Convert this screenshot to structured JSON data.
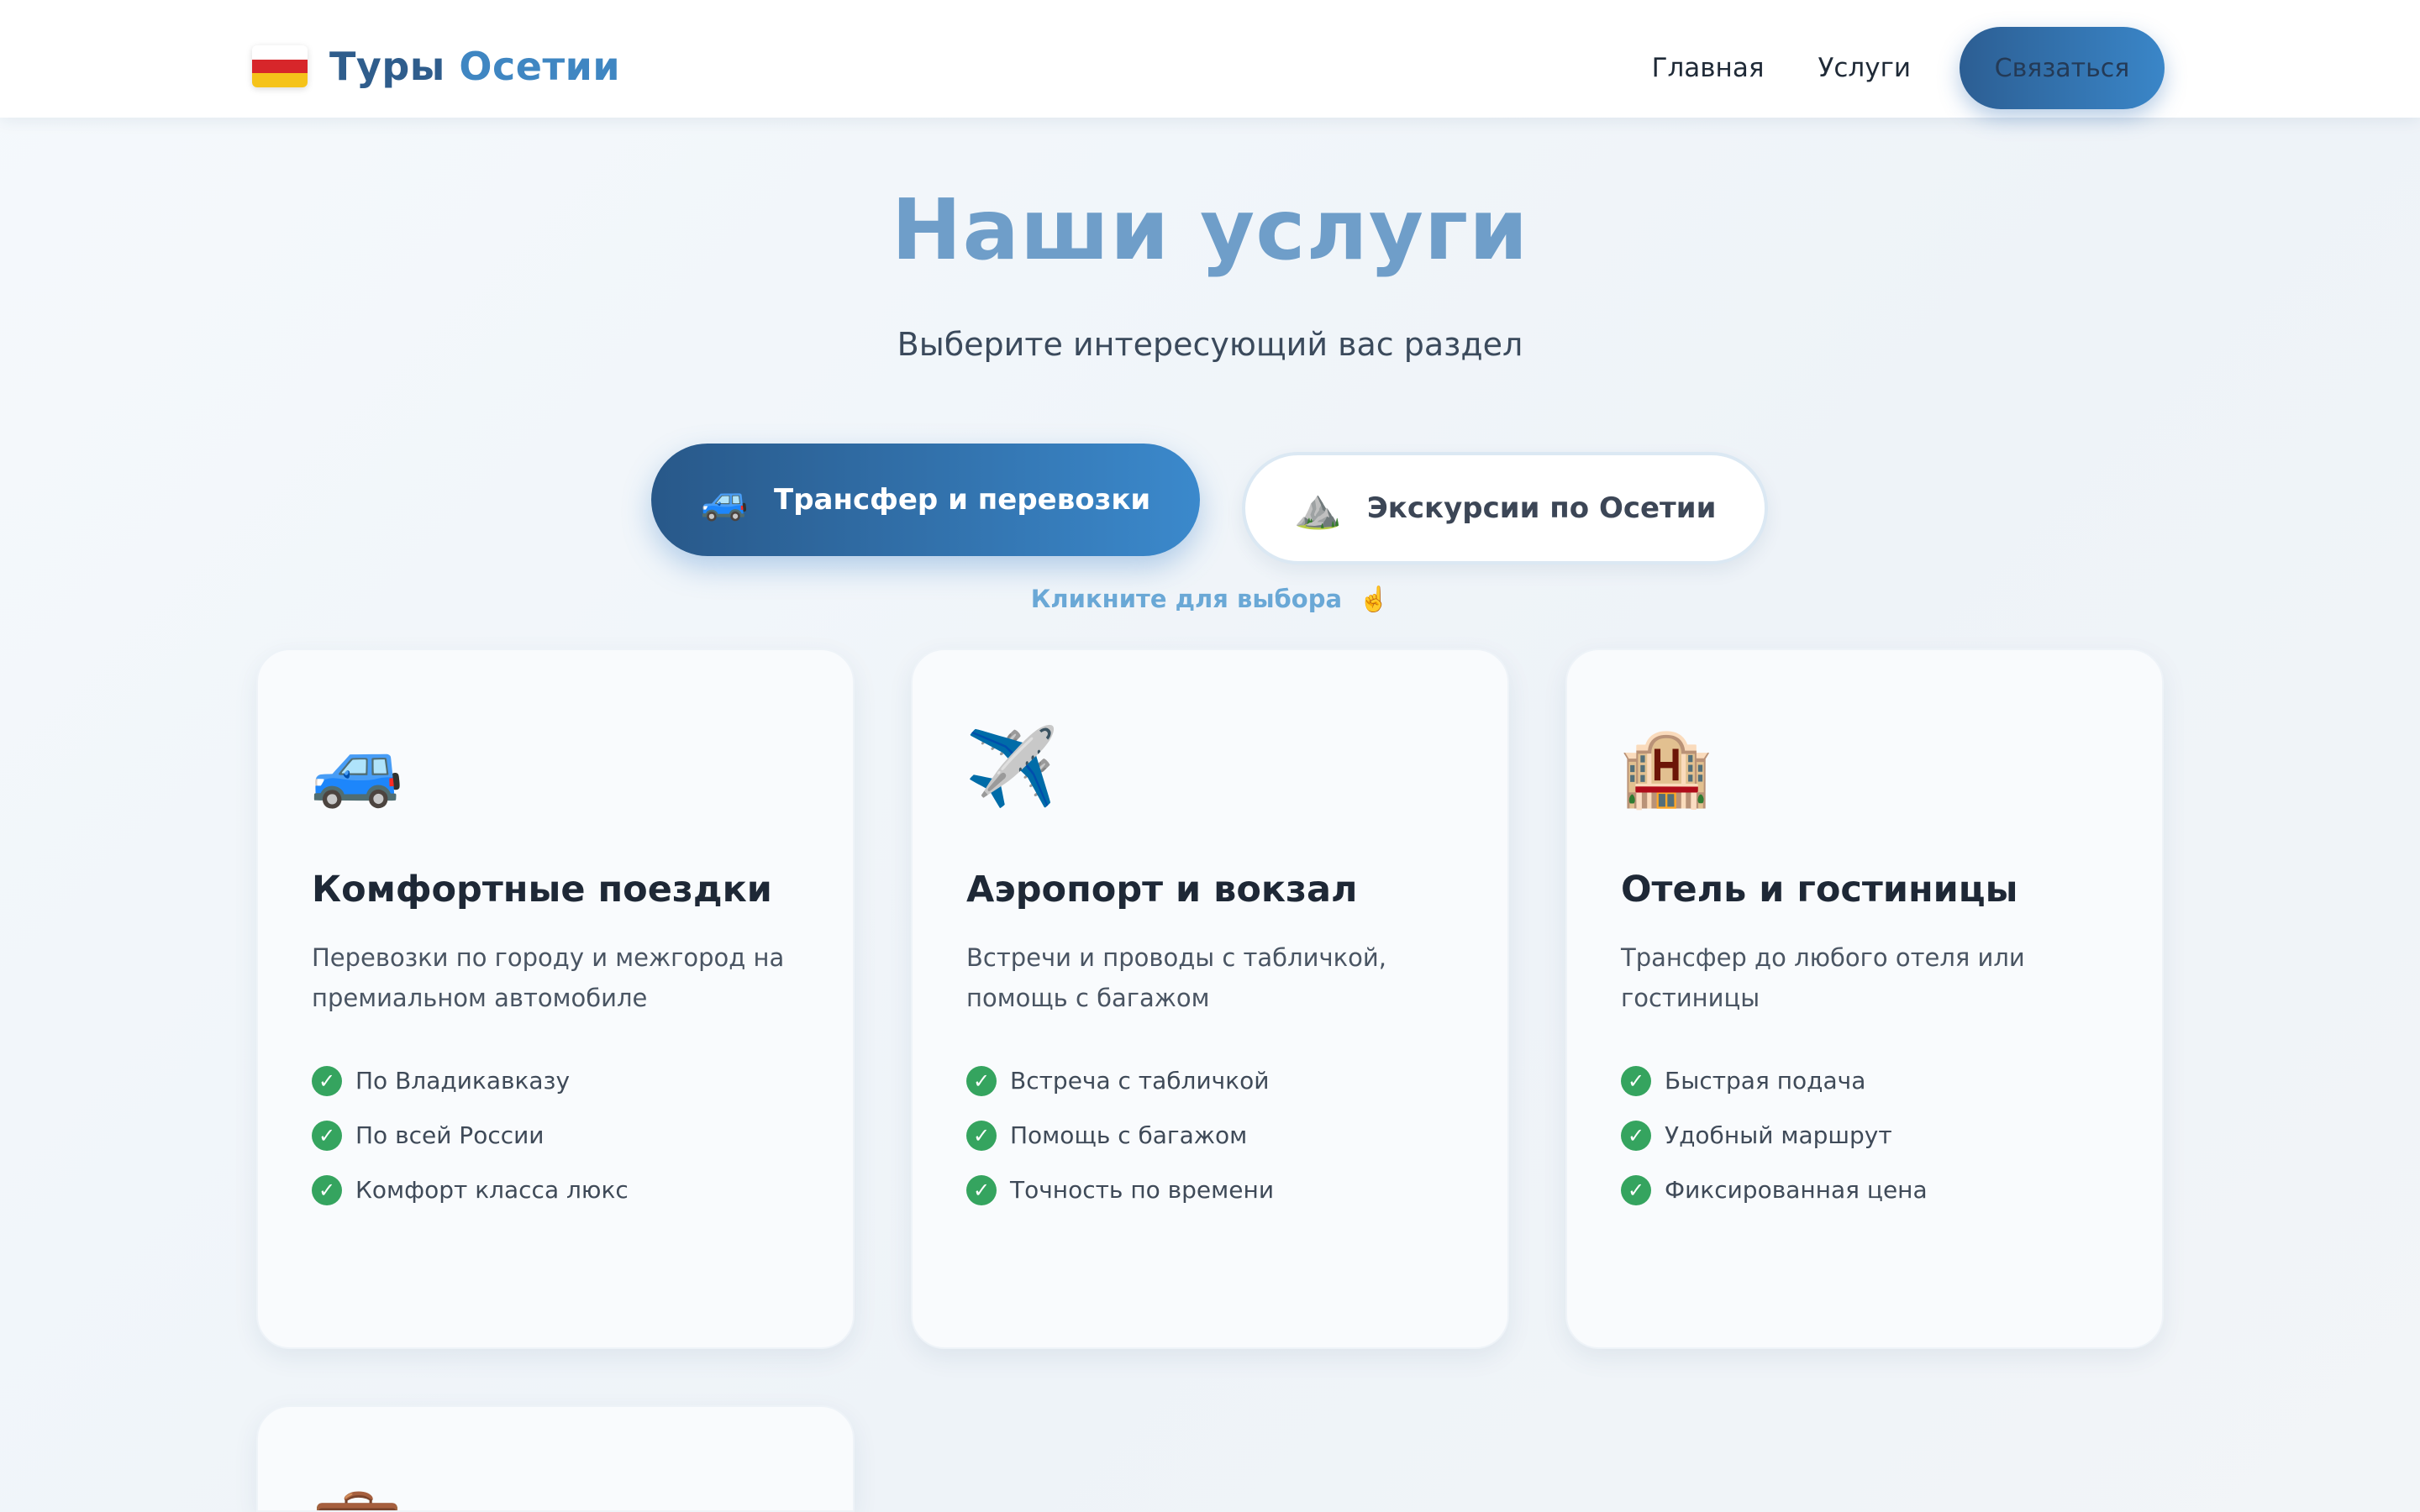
{
  "header": {
    "brand_part1": "Туры",
    "brand_part2": "Осетии",
    "flag_colors": [
      "#ffffff",
      "#d7262a",
      "#f5c31a"
    ],
    "nav": [
      "Главная",
      "Услуги"
    ],
    "cta_label": "Связаться"
  },
  "hero": {
    "title": "Наши услуги",
    "subtitle": "Выберите интересующий вас раздел"
  },
  "tabs": [
    {
      "icon": "🚙",
      "icon_name": "suv-icon",
      "label": "Трансфер и перевозки",
      "active": true
    },
    {
      "icon": "⛰️",
      "icon_name": "mountain-icon",
      "label": "Экскурсии по Осетии",
      "active": false
    }
  ],
  "hint": {
    "text": "Кликните для выбора",
    "icon": "☝️",
    "icon_name": "pointing-up-icon"
  },
  "cards": [
    {
      "icon": "🚙",
      "icon_name": "suv-icon",
      "title": "Комфортные поездки",
      "desc": "Перевозки по городу и межгород на премиальном автомобиле",
      "features": [
        "По Владикавказу",
        "По всей России",
        "Комфорт класса люкс"
      ]
    },
    {
      "icon": "✈️",
      "icon_name": "airplane-icon",
      "title": "Аэропорт и вокзал",
      "desc": "Встречи и проводы с табличкой, помощь с багажом",
      "features": [
        "Встреча с табличкой",
        "Помощь с багажом",
        "Точность по времени"
      ]
    },
    {
      "icon": "🏨",
      "icon_name": "hotel-icon",
      "title": "Отель и гостиницы",
      "desc": "Трансфер до любого отеля или гостиницы",
      "features": [
        "Быстрая подача",
        "Удобный маршрут",
        "Фиксированная цена"
      ]
    },
    {
      "icon": "💼",
      "icon_name": "briefcase-icon",
      "title": "",
      "desc": "",
      "features": []
    }
  ],
  "check_symbol": "✓",
  "colors": {
    "accent": "#3a86c8",
    "accent_dark": "#2c5e93",
    "check": "#35a45f"
  }
}
